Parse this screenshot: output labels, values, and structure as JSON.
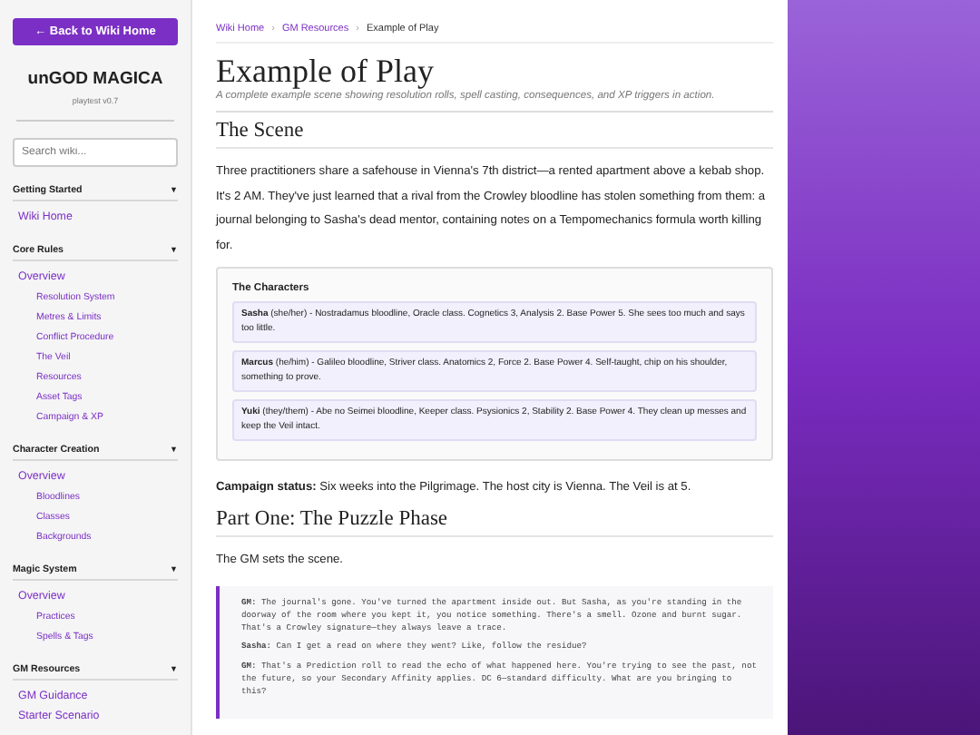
{
  "sidebar": {
    "back_button": "← Back to Wiki Home",
    "title": "unGOD MAGICA",
    "version": "playtest v0.7",
    "search": {
      "placeholder": "Search wiki..."
    },
    "sections": [
      {
        "title": "Getting Started",
        "toggle": "▼",
        "expanded": true,
        "items": [
          {
            "label": "Wiki Home"
          }
        ]
      },
      {
        "title": "Core Rules",
        "toggle": "▼",
        "expanded": true,
        "items": [
          {
            "label": "Overview",
            "children": [
              {
                "label": "Resolution System"
              },
              {
                "label": "Metres & Limits"
              },
              {
                "label": "Conflict Procedure"
              },
              {
                "label": "The Veil"
              },
              {
                "label": "Resources"
              },
              {
                "label": "Asset Tags"
              },
              {
                "label": "Campaign & XP"
              }
            ]
          }
        ]
      },
      {
        "title": "Character Creation",
        "toggle": "▼",
        "expanded": true,
        "items": [
          {
            "label": "Overview",
            "children": [
              {
                "label": "Bloodlines"
              },
              {
                "label": "Classes"
              },
              {
                "label": "Backgrounds"
              }
            ]
          }
        ]
      },
      {
        "title": "Magic System",
        "toggle": "▼",
        "expanded": true,
        "items": [
          {
            "label": "Overview",
            "children": [
              {
                "label": "Practices"
              },
              {
                "label": "Spells & Tags"
              }
            ]
          }
        ]
      },
      {
        "title": "GM Resources",
        "toggle": "▼",
        "expanded": true,
        "items": [
          {
            "label": "GM Guidance"
          },
          {
            "label": "Starter Scenario"
          }
        ]
      }
    ]
  },
  "breadcrumb": {
    "links": [
      "Wiki Home",
      "GM Resources"
    ],
    "separator": "›",
    "current": "Example of Play"
  },
  "page": {
    "title": "Example of Play",
    "subtitle": "A complete example scene showing resolution rolls, spell casting, consequences, and XP triggers in action.",
    "scene_heading": "The Scene",
    "scene_text": "Three practitioners share a safehouse in Vienna's 7th district—a rented apartment above a kebab shop. It's 2 AM. They've just learned that a rival from the Crowley bloodline has stolen something from them: a journal belonging to Sasha's dead mentor, containing notes on a Tempomechanics formula worth killing for.",
    "characters": {
      "title": "The Characters",
      "items": [
        "**Sasha** (she/her) - Nostradamus bloodline, Oracle class. Cognetics 3, Analysis 2. Base Power 5. She sees too much and says too little.",
        "**Marcus** (he/him) - Galileo bloodline, Striver class. Anatomics 2, Force 2. Base Power 4. Self-taught, chip on his shoulder, something to prove.",
        "**Yuki** (they/them) - Abe no Seimei bloodline, Keeper class. Psysionics 2, Stability 2. Base Power 4. They clean up messes and keep the Veil intact."
      ]
    },
    "campaign_status": "**Campaign status:** Six weeks into the Pilgrimage. The host city is Vienna. The Veil is at 5.",
    "part_heading": "Part One: The Puzzle Phase",
    "part_intro": "The GM sets the scene.",
    "dialogue": [
      "**GM:** The journal's gone. You've turned the apartment inside out. But Sasha, as you're standing in the doorway of the room where you kept it, you notice something. There's a smell. Ozone and burnt sugar. That's a Crowley signature—they always leave a trace.",
      "**Sasha:** Can I get a read on where they went? Like, follow the residue?",
      "**GM:** That's a Prediction roll to read the echo of what happened here. You're trying to see the past, not the future, so your Secondary Affinity applies. DC 6—standard difficulty. What are you bringing to this?"
    ]
  }
}
